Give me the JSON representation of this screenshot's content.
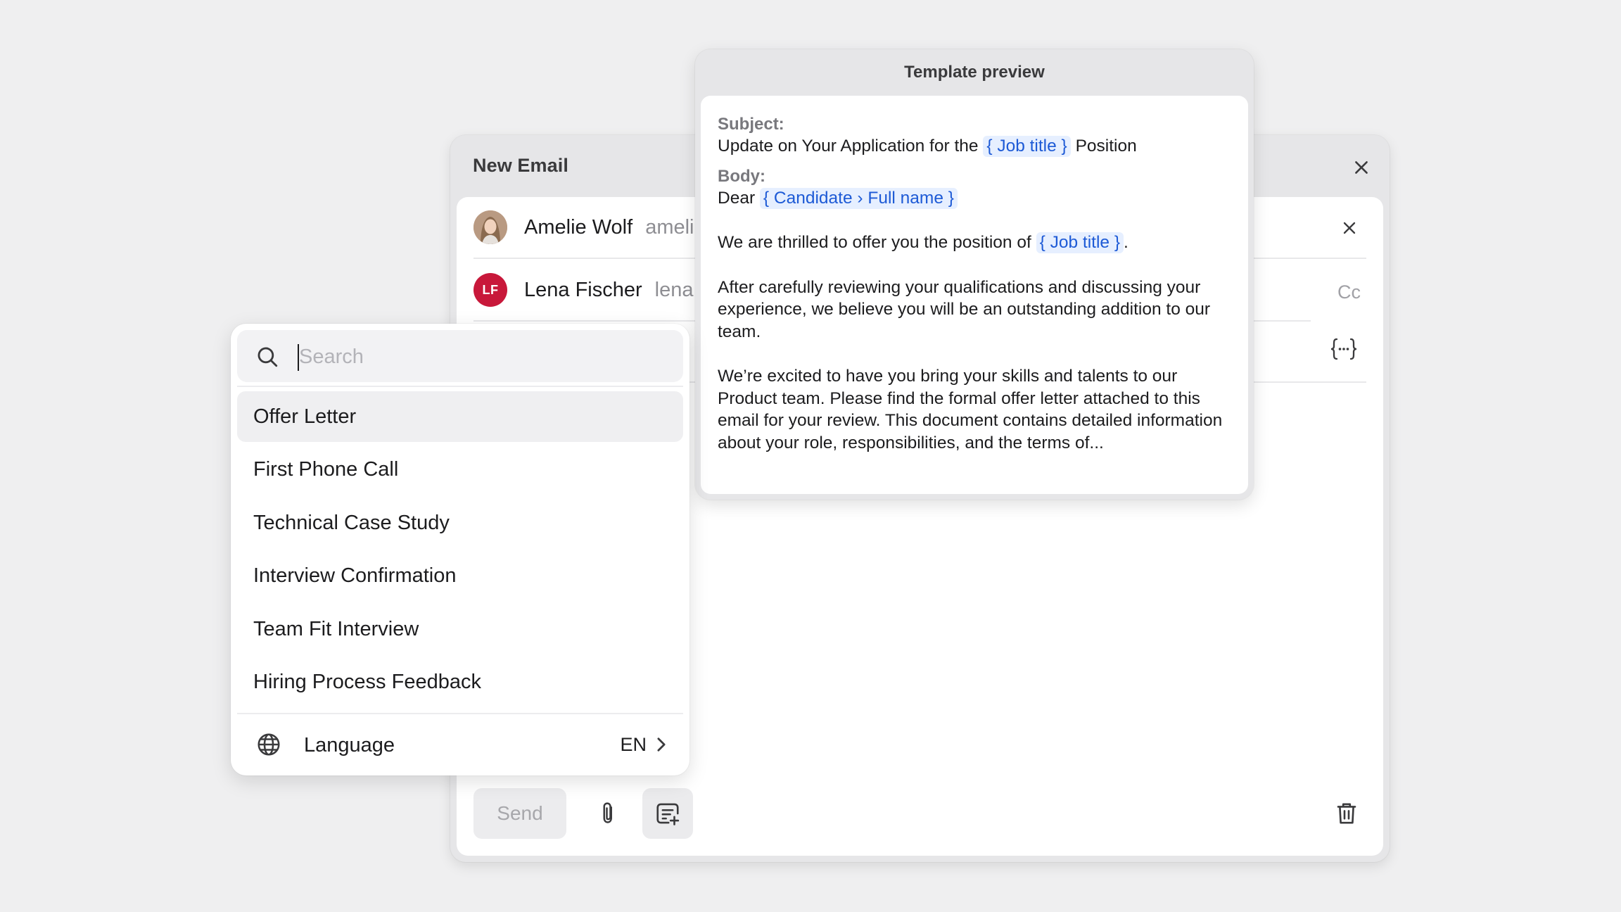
{
  "compose": {
    "title": "New Email",
    "recipients": [
      {
        "name": "Amelie Wolf",
        "email": "ameli",
        "avatar": "photo"
      },
      {
        "name": "Lena Fischer",
        "email": "lena",
        "initials": "LF",
        "avatar_color": "#c8183a"
      }
    ],
    "cc_label": "Cc",
    "send_label": "Send"
  },
  "dropdown": {
    "search": {
      "placeholder": "Search",
      "value": ""
    },
    "templates": [
      {
        "label": "Offer Letter",
        "active": true
      },
      {
        "label": "First Phone Call"
      },
      {
        "label": "Technical Case Study"
      },
      {
        "label": "Interview Confirmation"
      },
      {
        "label": "Team Fit Interview"
      },
      {
        "label": "Hiring Process Feedback"
      }
    ],
    "language": {
      "label": "Language",
      "value": "EN"
    }
  },
  "preview": {
    "title": "Template preview",
    "subject_label": "Subject:",
    "subject_prefix": "Update on Your Application for the",
    "subject_token": "{ Job title }",
    "subject_suffix": "Position",
    "body_label": "Body:",
    "greeting": "Dear",
    "greeting_token": "{ Candidate › Full name }",
    "p1_prefix": "We are thrilled to offer you the position of",
    "p1_token": "{ Job title }",
    "p1_suffix": ".",
    "p2": "After carefully reviewing your qualifications and discussing your experience, we believe you will be an outstanding addition to our team.",
    "p3": "We’re excited to have you bring your skills and talents to our Product team. Please find the formal offer letter attached to this email for your review. This document contains detailed information about your role, responsibilities, and the terms of..."
  },
  "colors": {
    "background": "#efeff0",
    "token_bg": "#e6efff",
    "token_text": "#1d5ad6",
    "avatar_lf": "#c8183a"
  },
  "icons": [
    "close-icon",
    "search-icon",
    "globe-icon",
    "chevron-right-icon",
    "paperclip-icon",
    "template-add-icon",
    "trash-icon",
    "variable-braces-icon"
  ]
}
